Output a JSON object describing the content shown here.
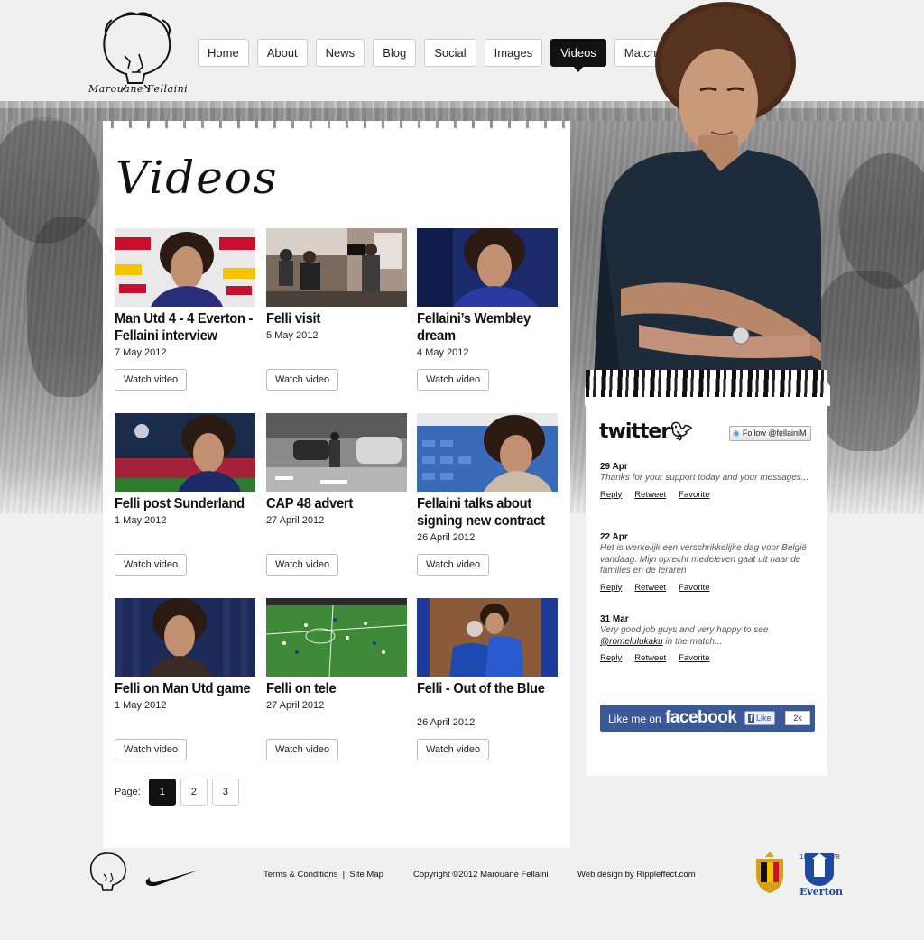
{
  "brand": {
    "name": "Marouane Fellaini"
  },
  "nav": {
    "items": [
      {
        "label": "Home"
      },
      {
        "label": "About"
      },
      {
        "label": "News"
      },
      {
        "label": "Blog"
      },
      {
        "label": "Social"
      },
      {
        "label": "Images"
      },
      {
        "label": "Videos",
        "active": true
      },
      {
        "label": "Matches"
      }
    ]
  },
  "main": {
    "title": "Videos",
    "watch_label": "Watch video",
    "videos": [
      {
        "title": "Man Utd 4 - 4 Everton - Fellaini interview",
        "date": "7 May 2012"
      },
      {
        "title": "Felli visit",
        "date": "5 May 2012"
      },
      {
        "title": "Fellaini’s Wembley dream",
        "date": "4 May 2012"
      },
      {
        "title": "Felli post Sunderland",
        "date": "1 May 2012"
      },
      {
        "title": "CAP 48 advert",
        "date": "27 April 2012"
      },
      {
        "title": "Fellaini talks about signing new contract",
        "date": "26 April 2012"
      },
      {
        "title": "Felli on Man Utd game",
        "date": "1 May 2012"
      },
      {
        "title": "Felli on tele",
        "date": "27 April 2012"
      },
      {
        "title": "Felli - Out of the Blue",
        "date": "26 April 2012"
      }
    ],
    "pager": {
      "label": "Page:",
      "pages": [
        "1",
        "2",
        "3"
      ],
      "current": "1"
    }
  },
  "sidebar": {
    "twitter": {
      "logo": "twitter",
      "follow_label": "Follow @fellainiM",
      "tweets": [
        {
          "date": "29 Apr",
          "text": "Thanks for your support today and your messages..."
        },
        {
          "date": "22 Apr",
          "text": "Het is werkelijk een verschrikkelijke dag voor België vandaag. Mijn oprecht medeleven gaat uit naar de families en de leraren"
        },
        {
          "date": "31 Mar",
          "text_before": "Very good job guys and very happy to see",
          "mention": "@romelulukaku",
          "text_after": "in the match..."
        }
      ],
      "actions": {
        "reply": "Reply",
        "retweet": "Retweet",
        "favorite": "Favorite"
      }
    },
    "facebook": {
      "prefix": "Like me on",
      "brand": "facebook",
      "like_label": "Like",
      "count": "2k"
    }
  },
  "footer": {
    "terms": "Terms & Conditions",
    "separator": "|",
    "sitemap": "Site Map",
    "copyright": "Copyright ©2012 Marouane Fellaini",
    "credit": "Web design by Rippleffect.com",
    "club_name": "Everton"
  },
  "colors": {
    "nav_active": "#111111",
    "facebook": "#3b5998",
    "everton_blue": "#1d4aa0"
  }
}
